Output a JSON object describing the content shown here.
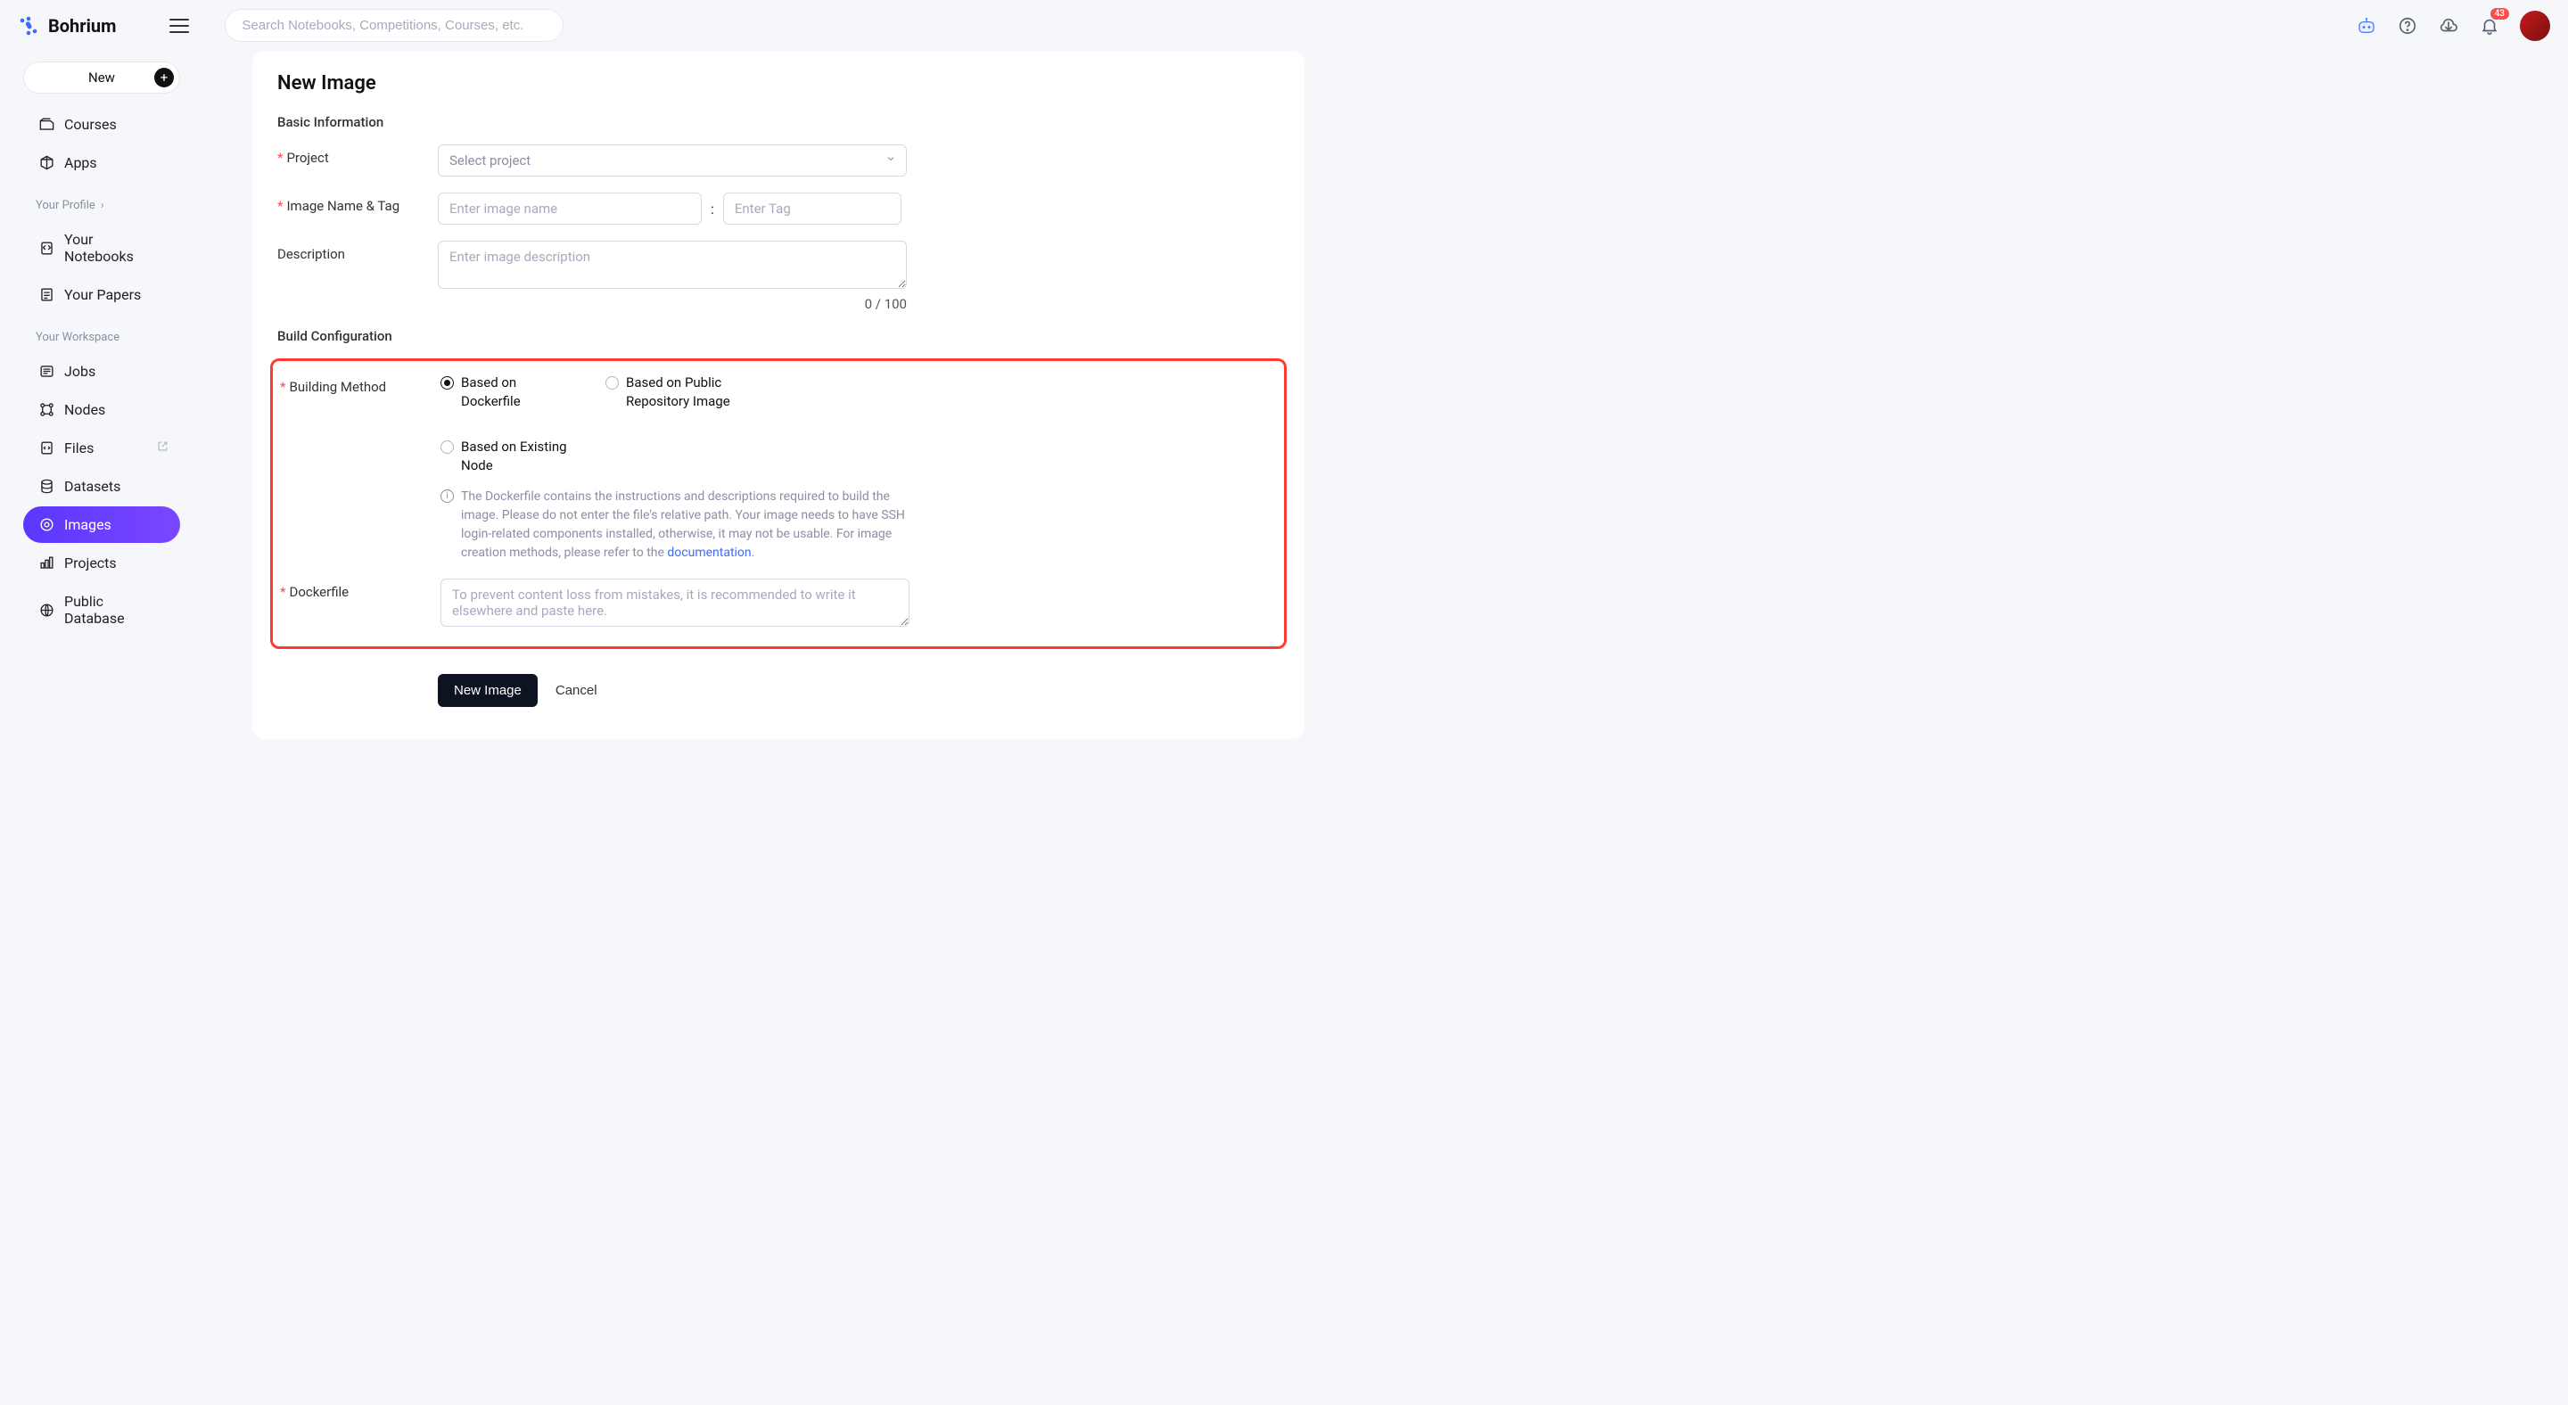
{
  "brand": "Bohrium",
  "search_placeholder": "Search Notebooks, Competitions, Courses, etc.",
  "notification_count": "43",
  "sidebar": {
    "new_label": "New",
    "top": [
      {
        "label": "Courses",
        "icon": "courses"
      },
      {
        "label": "Apps",
        "icon": "apps"
      }
    ],
    "profile_header": "Your Profile",
    "profile": [
      {
        "label": "Your Notebooks",
        "icon": "notebooks"
      },
      {
        "label": "Your Papers",
        "icon": "papers"
      }
    ],
    "workspace_header": "Your Workspace",
    "workspace": [
      {
        "label": "Jobs",
        "icon": "jobs"
      },
      {
        "label": "Nodes",
        "icon": "nodes"
      },
      {
        "label": "Files",
        "icon": "files",
        "ext": true
      },
      {
        "label": "Datasets",
        "icon": "datasets"
      },
      {
        "label": "Images",
        "icon": "images",
        "active": true
      },
      {
        "label": "Projects",
        "icon": "projects"
      },
      {
        "label": "Public Database",
        "icon": "public-db"
      }
    ]
  },
  "page": {
    "title": "New Image",
    "sections": {
      "basic": "Basic Information",
      "build": "Build Configuration"
    },
    "labels": {
      "project": "Project",
      "image_name": "Image Name & Tag",
      "description": "Description",
      "building_method": "Building Method",
      "dockerfile": "Dockerfile"
    },
    "placeholders": {
      "project": "Select project",
      "image_name": "Enter image name",
      "tag": "Enter Tag",
      "description": "Enter image description",
      "dockerfile": "To prevent content loss from mistakes, it is recommended to write it elsewhere and paste here."
    },
    "counter": "0 / 100",
    "radio": {
      "dockerfile": "Based on Dockerfile",
      "public_repo": "Based on Public Repository Image",
      "existing_node": "Based on Existing Node"
    },
    "info_text_pre": "The Dockerfile contains the instructions and descriptions required to build the image. Please do not enter the file's relative path. Your image needs to have SSH login-related components installed, otherwise, it may not be usable. For image creation methods, please refer to the ",
    "info_link": "documentation",
    "info_text_post": ".",
    "actions": {
      "submit": "New Image",
      "cancel": "Cancel"
    }
  }
}
